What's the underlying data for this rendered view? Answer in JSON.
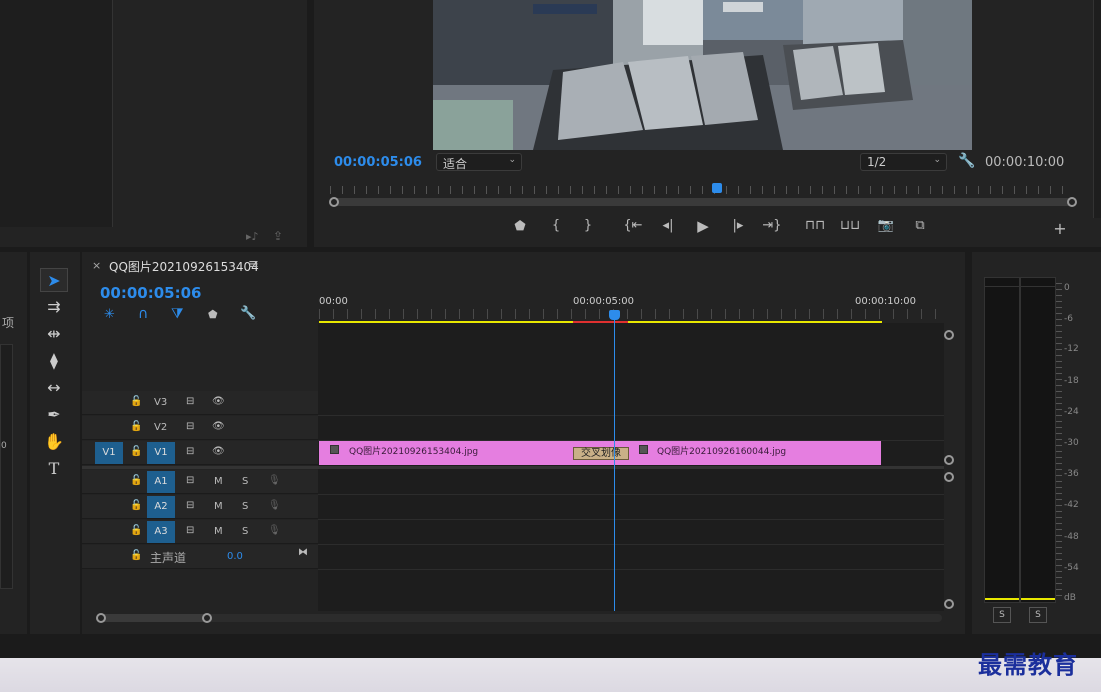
{
  "program": {
    "timecode_current": "00:00:05:06",
    "fit_select": "适合",
    "resolution_select": "1/2",
    "timecode_duration": "00:00:10:00"
  },
  "timeline": {
    "close": "×",
    "sequence_name": "QQ图片20210926153404",
    "menu_icon": "≡",
    "timecode": "00:00:05:06",
    "ruler": [
      "00:00",
      "00:00:05:00",
      "00:00:10:00"
    ],
    "tracks_video": [
      {
        "name": "V3"
      },
      {
        "name": "V2"
      },
      {
        "name": "V1",
        "source": "V1"
      }
    ],
    "tracks_audio": [
      {
        "name": "A1",
        "m": "M",
        "s": "S"
      },
      {
        "name": "A2",
        "m": "M",
        "s": "S"
      },
      {
        "name": "A3",
        "m": "M",
        "s": "S"
      }
    ],
    "master": {
      "label": "主声道",
      "value": "0.0"
    },
    "clips": [
      {
        "label": "QQ图片20210926153404.jpg"
      },
      {
        "label": "QQ图片20210926160044.jpg"
      }
    ],
    "transition": "交叉划像"
  },
  "left_panel": {
    "fragment_text": "项",
    "fragment_num": "0"
  },
  "meter": {
    "db_labels": [
      "0",
      "-6",
      "-12",
      "-18",
      "-24",
      "-30",
      "-36",
      "-42",
      "-48",
      "-54",
      "dB"
    ],
    "solo_left": "S",
    "solo_right": "S"
  },
  "watermark": "最需教育",
  "colors": {
    "accent": "#2d8ceb",
    "clip": "#e57ee0",
    "work_area": "#e8e800",
    "render_red": "#e03030"
  }
}
